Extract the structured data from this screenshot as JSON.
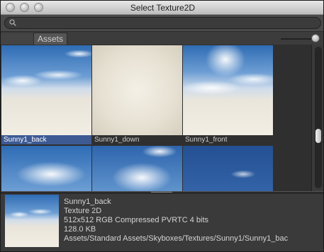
{
  "window": {
    "title": "Select Texture2D"
  },
  "search": {
    "value": "",
    "placeholder": ""
  },
  "tabs": {
    "assets": "Assets"
  },
  "grid": {
    "items": [
      {
        "label": "Sunny1_back",
        "selected": true
      },
      {
        "label": "Sunny1_down",
        "selected": false
      },
      {
        "label": "Sunny1_front",
        "selected": false
      },
      {
        "label": "",
        "selected": false
      },
      {
        "label": "",
        "selected": false
      },
      {
        "label": "",
        "selected": false
      }
    ]
  },
  "info": {
    "name": "Sunny1_back",
    "type": "Texture 2D",
    "format": "512x512  RGB Compressed PVRTC 4 bits",
    "size": "128.0 KB",
    "path": "Assets/Standard Assets/Skyboxes/Textures/Sunny1/Sunny1_bac"
  },
  "colors": {
    "selection": "#3d5a93",
    "background": "#3a3a3a"
  },
  "icons": {
    "search": "search-icon"
  }
}
